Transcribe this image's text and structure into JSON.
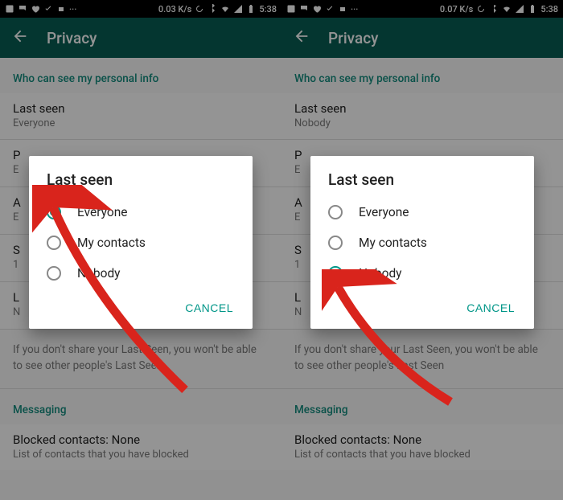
{
  "accent": "#009688",
  "statusbar": {
    "data_rate_left": "0.03 K/s",
    "data_rate_right": "0.07 K/s",
    "time": "5:38"
  },
  "header": {
    "title": "Privacy"
  },
  "section": {
    "personal_info": "Who can see my personal info",
    "messaging": "Messaging"
  },
  "settings": {
    "last_seen_label": "Last seen",
    "profile_photo_label": "P",
    "profile_photo_value": "E",
    "about_label": "A",
    "about_value": "E",
    "status_label": "S",
    "status_value": "1",
    "live_location_label": "L",
    "live_location_value": "N",
    "blocked_label": "Blocked contacts: None",
    "blocked_hint": "List of contacts that you have blocked"
  },
  "hint": {
    "last_seen": "If you don't share your Last Seen, you won't be able to see other people's Last Seen"
  },
  "dialog": {
    "title": "Last seen",
    "options": [
      "Everyone",
      "My contacts",
      "Nobody"
    ],
    "cancel": "CANCEL"
  },
  "left_pane": {
    "last_seen_value": "Everyone",
    "selected_option": "Everyone"
  },
  "right_pane": {
    "last_seen_value": "Nobody",
    "selected_option": "Nobody"
  }
}
